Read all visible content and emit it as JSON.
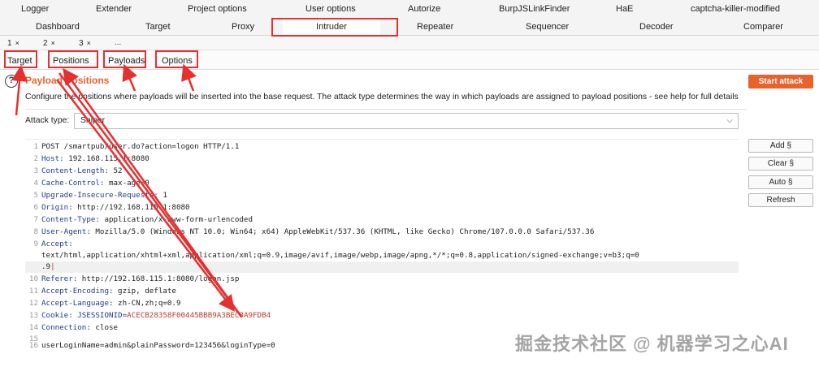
{
  "top_tabs_row1": [
    "Logger",
    "Extender",
    "Project options",
    "User options",
    "Autorize",
    "BurpJSLinkFinder",
    "HaE",
    "captcha-killer-modified"
  ],
  "top_tabs_row2": [
    "Dashboard",
    "Target",
    "Proxy",
    "Intruder",
    "Repeater",
    "Sequencer",
    "Decoder",
    "Comparer"
  ],
  "sub_tabs": [
    {
      "label": "1",
      "close": "×"
    },
    {
      "label": "2",
      "close": "×"
    },
    {
      "label": "3",
      "close": "×"
    },
    {
      "label": "...",
      "close": ""
    }
  ],
  "intruder_tabs": [
    "Target",
    "Positions",
    "Payloads",
    "Options"
  ],
  "section": {
    "help": "?",
    "title": "Payload Positions",
    "start_button": "Start attack",
    "description": "Configure the positions where payloads will be inserted into the base request. The attack type determines the way in which payloads are assigned to payload positions - see help for full details"
  },
  "attack": {
    "label": "Attack type:",
    "value": "Sniper",
    "chevron": "⌵"
  },
  "request_lines": [
    {
      "n": "1",
      "plain": "POST /smartpub/user.do?action=logon HTTP/1.1"
    },
    {
      "n": "2",
      "key": "Host:",
      "val": " 192.168.115.1:8080"
    },
    {
      "n": "3",
      "key": "Content-Length:",
      "val": " 52"
    },
    {
      "n": "4",
      "key": "Cache-Control:",
      "val": " max-age=0"
    },
    {
      "n": "5",
      "key": "Upgrade-Insecure-Requests:",
      "val": " 1"
    },
    {
      "n": "6",
      "key": "Origin:",
      "val": " http://192.168.115.1:8080"
    },
    {
      "n": "7",
      "key": "Content-Type:",
      "val": " application/x-www-form-urlencoded"
    },
    {
      "n": "8",
      "key": "User-Agent:",
      "val": " Mozilla/5.0 (Windows NT 10.0; Win64; x64) AppleWebKit/537.36 (KHTML, like Gecko) Chrome/107.0.0.0 Safari/537.36"
    },
    {
      "n": "9",
      "key": "Accept:",
      "val": ""
    },
    {
      "n": "",
      "plain": "text/html,application/xhtml+xml,application/xml;q=0.9,image/avif,image/webp,image/apng,*/*;q=0.8,application/signed-exchange;v=b3;q=0"
    },
    {
      "n": "",
      "plain": ".9"
    },
    {
      "n": "10",
      "key": "Referer:",
      "val": " http://192.168.115.1:8080/logon.jsp"
    },
    {
      "n": "11",
      "key": "Accept-Encoding:",
      "val": " gzip, deflate"
    },
    {
      "n": "12",
      "key": "Accept-Language:",
      "val": " zh-CN,zh;q=0.9"
    },
    {
      "n": "13",
      "key": "Cookie:",
      "cookie_name": " JSESSIONID=",
      "cookie_val": "ACECB28358F00445BBB9A3BEC3A9FDB4"
    },
    {
      "n": "14",
      "key": "Connection:",
      "val": " close"
    },
    {
      "n": "15",
      "plain": ""
    },
    {
      "n": "16",
      "plain": "userLoginName=admin&plainPassword=123456&loginType=0"
    }
  ],
  "side_buttons": [
    "Add §",
    "Clear §",
    "Auto §",
    "Refresh"
  ],
  "watermark": "掘金技术社区 @ 机器学习之心AI",
  "colors": {
    "accent": "#e8622c",
    "annotation_red": "#e53030"
  }
}
